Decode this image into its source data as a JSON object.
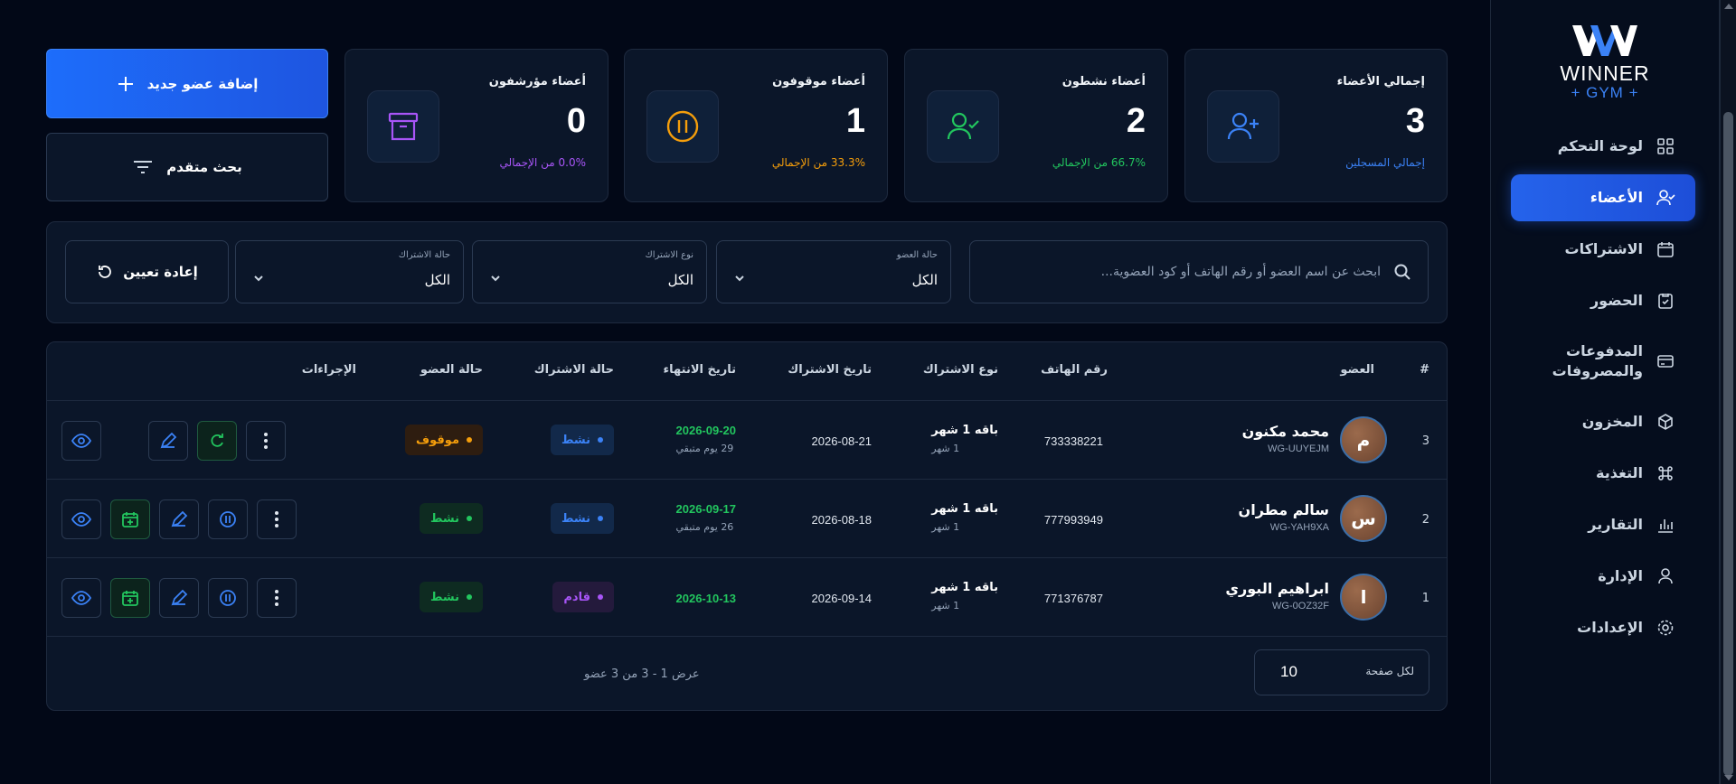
{
  "brand": {
    "name": "WINNER",
    "sub": "+ GYM +",
    "accent": "#2563eb"
  },
  "nav": [
    {
      "label": "لوحة التحكم",
      "icon": "dashboard-grid-icon"
    },
    {
      "label": "الأعضاء",
      "icon": "users-check-icon",
      "active": true
    },
    {
      "label": "الاشتراكات",
      "icon": "calendar-icon"
    },
    {
      "label": "الحضور",
      "icon": "clipboard-check-icon"
    },
    {
      "label": "المدفوعات والمصروفات",
      "icon": "credit-card-icon"
    },
    {
      "label": "المخزون",
      "icon": "box-icon"
    },
    {
      "label": "التغذية",
      "icon": "command-icon"
    },
    {
      "label": "التقارير",
      "icon": "bar-chart-icon"
    },
    {
      "label": "الإدارة",
      "icon": "user-icon"
    },
    {
      "label": "الإعدادات",
      "icon": "gear-icon"
    }
  ],
  "stats": [
    {
      "title": "إجمالي الأعضاء",
      "value": "3",
      "sub": "إجمالي المسجلين",
      "color": "#3b82f6"
    },
    {
      "title": "أعضاء نشطون",
      "value": "2",
      "sub": "66.7% من الإجمالي",
      "color": "#22c55e"
    },
    {
      "title": "أعضاء موقوفون",
      "value": "1",
      "sub": "33.3% من الإجمالي",
      "color": "#f59e0b"
    },
    {
      "title": "أعضاء مؤرشفون",
      "value": "0",
      "sub": "0.0% من الإجمالي",
      "color": "#a855f7"
    }
  ],
  "actions": {
    "add_member": "إضافة عضو جديد",
    "advanced_search": "بحث متقدم",
    "reset": "إعادة تعيين"
  },
  "search": {
    "placeholder": "ابحث عن اسم العضو أو رقم الهاتف أو كود العضوية..."
  },
  "filters": [
    {
      "caption": "حالة العضو",
      "value": "الكل"
    },
    {
      "caption": "نوع الاشتراك",
      "value": "الكل"
    },
    {
      "caption": "حالة الاشتراك",
      "value": "الكل"
    }
  ],
  "table": {
    "headers": {
      "num": "#",
      "member": "العضو",
      "phone": "رقم الهاتف",
      "type": "نوع الاشتراك",
      "start": "تاريخ الاشتراك",
      "end": "تاريخ الانتهاء",
      "sub_status": "حالة الاشتراك",
      "member_status": "حالة العضو",
      "actions": "الإجراءات"
    },
    "rows": [
      {
        "num": "3",
        "initial": "م",
        "name": "محمد مكنون",
        "code": "WG-UUYEJM",
        "phone": "733338221",
        "plan": "باقه 1 شهر",
        "plan_sub": "1 شهر",
        "start": "2026-08-21",
        "end": "2026-09-20",
        "remain": "29 يوم متبقي",
        "sub_status": "نشط",
        "member_status": "موقوف"
      },
      {
        "num": "2",
        "initial": "س",
        "name": "سالم مطران",
        "code": "WG-YAH9XA",
        "phone": "777993949",
        "plan": "باقه 1 شهر",
        "plan_sub": "1 شهر",
        "start": "2026-08-18",
        "end": "2026-09-17",
        "remain": "26 يوم متبقي",
        "sub_status": "نشط",
        "member_status": "نشط"
      },
      {
        "num": "1",
        "initial": "ا",
        "name": "ابراهيم البوري",
        "code": "WG-0OZ32F",
        "phone": "771376787",
        "plan": "باقه 1 شهر",
        "plan_sub": "1 شهر",
        "start": "2026-09-14",
        "end": "2026-10-13",
        "remain": "",
        "sub_status": "قادم",
        "member_status": "نشط"
      }
    ]
  },
  "footer": {
    "showing": "عرض 1 - 3 من 3 عضو",
    "per_page_label": "لكل صفحة",
    "per_page": "10"
  }
}
